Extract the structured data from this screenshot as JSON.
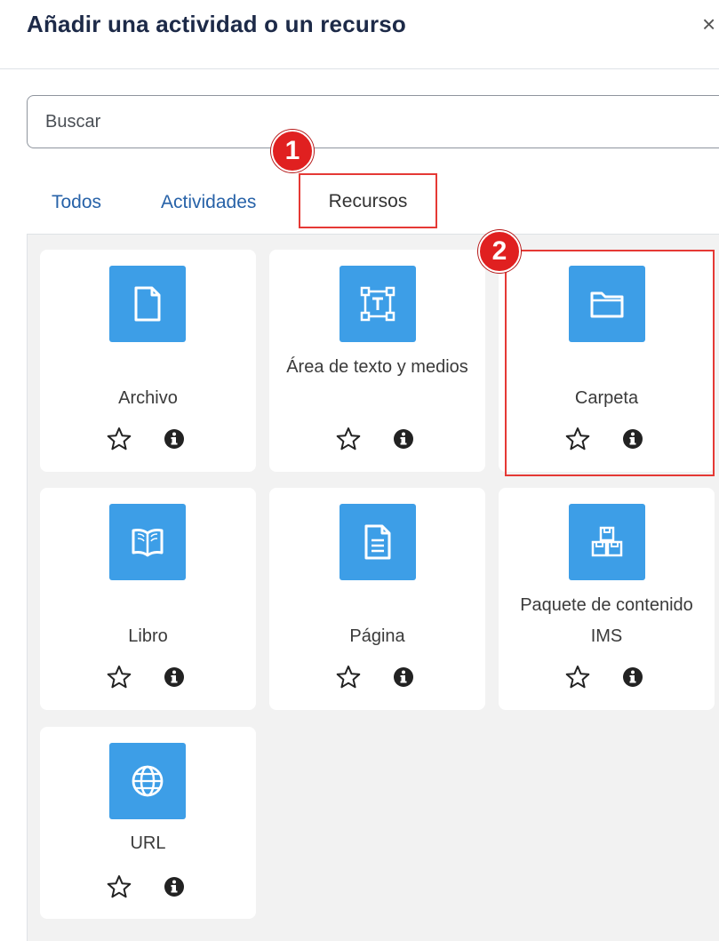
{
  "modal": {
    "title": "Añadir una actividad o un recurso",
    "close_glyph": "×"
  },
  "search": {
    "placeholder": "Buscar"
  },
  "tabs": [
    {
      "label": "Todos",
      "active": false
    },
    {
      "label": "Actividades",
      "active": false
    },
    {
      "label": "Recursos",
      "active": true
    }
  ],
  "items": [
    {
      "label": "Archivo",
      "icon": "file-icon"
    },
    {
      "label": "Área de texto y medios",
      "icon": "text-area-icon"
    },
    {
      "label": "Carpeta",
      "icon": "folder-icon"
    },
    {
      "label": "Libro",
      "icon": "book-icon"
    },
    {
      "label": "Página",
      "icon": "page-icon"
    },
    {
      "label": "Paquete de contenido IMS",
      "icon": "ims-package-icon"
    },
    {
      "label": "URL",
      "icon": "globe-icon"
    }
  ],
  "annotations": {
    "callout_1": "1",
    "callout_2": "2"
  },
  "colors": {
    "accent": "#3d9ee7",
    "link": "#2762a8",
    "title": "#1d2a48",
    "annotation_red": "#e02020",
    "chooser_background": "#f2f2f2"
  }
}
